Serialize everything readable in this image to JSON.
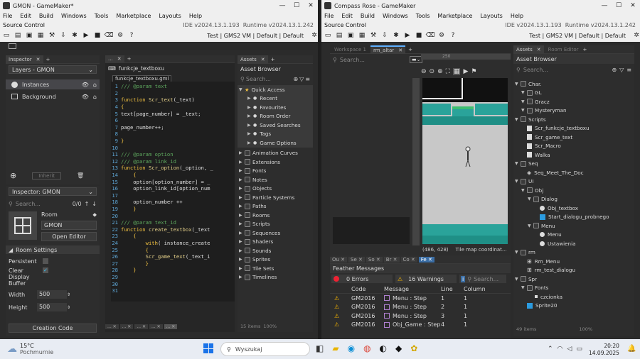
{
  "left": {
    "title": "GMON - GameMaker*",
    "menu": [
      "File",
      "Edit",
      "Build",
      "Windows",
      "Tools",
      "Marketplace",
      "Layouts",
      "Help"
    ],
    "source_control": "Source Control",
    "ide_version": "IDE v2024.13.1.193",
    "runtime_version": "Runtime v2024.13.1.242",
    "target": "Test | GMS2 VM | Default | Default",
    "inspector_tab": "Inspector",
    "layers_title": "Layers - GMON",
    "layers": [
      "Instances",
      "Background"
    ],
    "inherit": "Inherit",
    "inspector2": "Inspector: GMON",
    "search_ph": "Search...",
    "count": "0/0",
    "room_label": "Room",
    "room_name": "GMON",
    "open_editor": "Open Editor",
    "room_settings": "Room Settings",
    "persistent": "Persistent",
    "clear_display": "Clear Display Buffer",
    "width_label": "Width",
    "width_val": "500",
    "height_label": "Height",
    "height_val": "500",
    "creation_code": "Creation Code",
    "code_tab_outer": "funkcje_textboxu",
    "code_file_tab": "funkcje_textboxu.gml",
    "code_lines": [
      {
        "n": "1",
        "parts": [
          {
            "c": "cm",
            "t": "/// @param text"
          }
        ]
      },
      {
        "n": "2",
        "parts": []
      },
      {
        "n": "3",
        "parts": [
          {
            "c": "kw",
            "t": "function "
          },
          {
            "c": "fn",
            "t": "Scr_text"
          },
          {
            "c": "tx",
            "t": "(_text)"
          }
        ]
      },
      {
        "n": "4",
        "parts": [
          {
            "c": "kw",
            "t": "{"
          }
        ]
      },
      {
        "n": "5",
        "parts": [
          {
            "c": "tx",
            "t": "text[page_number] = _text;"
          }
        ]
      },
      {
        "n": "6",
        "parts": []
      },
      {
        "n": "7",
        "parts": [
          {
            "c": "tx",
            "t": "page_number++;"
          }
        ]
      },
      {
        "n": "8",
        "parts": []
      },
      {
        "n": "9",
        "parts": [
          {
            "c": "kw",
            "t": "}"
          }
        ]
      },
      {
        "n": "10",
        "parts": []
      },
      {
        "n": "11",
        "parts": [
          {
            "c": "cm",
            "t": "/// @param option"
          }
        ]
      },
      {
        "n": "12",
        "parts": [
          {
            "c": "cm",
            "t": "/// @param link_id"
          }
        ]
      },
      {
        "n": "13",
        "parts": [
          {
            "c": "kw",
            "t": "function "
          },
          {
            "c": "fn",
            "t": "Scr_option"
          },
          {
            "c": "tx",
            "t": "(_option, _"
          }
        ]
      },
      {
        "n": "14",
        "parts": [
          {
            "c": "kw",
            "t": "    {"
          }
        ]
      },
      {
        "n": "15",
        "parts": [
          {
            "c": "tx",
            "t": "    option[option_number] = _"
          }
        ]
      },
      {
        "n": "16",
        "parts": [
          {
            "c": "tx",
            "t": "    option_link_id[option_num"
          }
        ]
      },
      {
        "n": "17",
        "parts": []
      },
      {
        "n": "18",
        "parts": [
          {
            "c": "tx",
            "t": "    option_number ++"
          }
        ]
      },
      {
        "n": "19",
        "parts": [
          {
            "c": "kw",
            "t": "    }"
          }
        ]
      },
      {
        "n": "20",
        "parts": []
      },
      {
        "n": "21",
        "parts": [
          {
            "c": "cm",
            "t": "/// @param text_id"
          }
        ]
      },
      {
        "n": "22",
        "parts": [
          {
            "c": "kw",
            "t": "function "
          },
          {
            "c": "fn",
            "t": "create_textbox"
          },
          {
            "c": "tx",
            "t": "(_text"
          }
        ]
      },
      {
        "n": "23",
        "parts": [
          {
            "c": "kw",
            "t": "    {"
          }
        ]
      },
      {
        "n": "24",
        "parts": [
          {
            "c": "kw",
            "t": "        with"
          },
          {
            "c": "tx",
            "t": "( instance_create"
          }
        ]
      },
      {
        "n": "25",
        "parts": [
          {
            "c": "kw",
            "t": "        {"
          }
        ]
      },
      {
        "n": "26",
        "parts": [
          {
            "c": "fn",
            "t": "        Scr_game_text"
          },
          {
            "c": "tx",
            "t": "(_text_i"
          }
        ]
      },
      {
        "n": "27",
        "parts": [
          {
            "c": "kw",
            "t": "        }"
          }
        ]
      },
      {
        "n": "28",
        "parts": [
          {
            "c": "kw",
            "t": "    }"
          }
        ]
      },
      {
        "n": "29",
        "parts": []
      },
      {
        "n": "30",
        "parts": []
      },
      {
        "n": "31",
        "parts": []
      }
    ],
    "assets_tab": "Assets",
    "asset_browser": "Asset Browser",
    "quick_access": "Quick Access",
    "qa_items": [
      "Recent",
      "Favourites",
      "Room Order",
      "Saved Searches",
      "Tags",
      "Game Options"
    ],
    "asset_groups": [
      "Animation Curves",
      "Extensions",
      "Fonts",
      "Notes",
      "Objects",
      "Particle Systems",
      "Paths",
      "Rooms",
      "Scripts",
      "Sequences",
      "Shaders",
      "Sounds",
      "Sprites",
      "Tile Sets",
      "Timelines"
    ],
    "items_status": "15 items",
    "zoom_status": "100%"
  },
  "right": {
    "title": "Compass Rose - GameMaker",
    "menu": [
      "File",
      "Edit",
      "Build",
      "Windows",
      "Tools",
      "Marketplace",
      "Layouts",
      "Help"
    ],
    "source_control": "Source Control",
    "ide_version": "IDE v2024.13.1.193",
    "runtime_version": "Runtime v2024.13.1.242",
    "target": "Test | GMS2 VM | Default | Default",
    "tab_workspace": "Workspace 1",
    "tab_room": "rm_altar",
    "search_ph": "Search...",
    "ruler": "250",
    "coords": "(486, 428)",
    "tile_coords": "Tile map coordinat...",
    "bottom_tabs": [
      "Ou",
      "Se",
      "So",
      "Br",
      "Co",
      "Fe"
    ],
    "feather_title": "Feather Messages",
    "errors": "0 Errors",
    "warnings": "16 Warnings",
    "col_code": "Code",
    "col_message": "Message",
    "col_line": "Line",
    "col_column": "Column",
    "messages": [
      {
        "code": "GM2016",
        "msg": "Menu : Step",
        "line": "1",
        "col": "1"
      },
      {
        "code": "GM2016",
        "msg": "Menu : Step",
        "line": "2",
        "col": "1"
      },
      {
        "code": "GM2016",
        "msg": "Menu : Step",
        "line": "3",
        "col": "1"
      },
      {
        "code": "GM2016",
        "msg": "Obj_Game : Step",
        "line": "4",
        "col": "1"
      }
    ],
    "assets_tab": "Assets",
    "room_editor_tab": "Room Editor",
    "asset_browser": "Asset Browser",
    "tree": [
      {
        "d": 1,
        "t": "Char.",
        "k": "fold"
      },
      {
        "d": 2,
        "t": "GL",
        "k": "fold"
      },
      {
        "d": 2,
        "t": "Gracz",
        "k": "fold"
      },
      {
        "d": 2,
        "t": "Mysteryman",
        "k": "fold"
      },
      {
        "d": 1,
        "t": "Scripts",
        "k": "fold"
      },
      {
        "d": 2,
        "t": "Scr_funkcje_textboxu",
        "k": "doc"
      },
      {
        "d": 2,
        "t": "Scr_game_text",
        "k": "doc"
      },
      {
        "d": 2,
        "t": "Scr_Macro",
        "k": "doc"
      },
      {
        "d": 2,
        "t": "Walka",
        "k": "doc"
      },
      {
        "d": 1,
        "t": "Seq",
        "k": "fold"
      },
      {
        "d": 2,
        "t": "Seq_Meet_The_Doc",
        "k": "seq"
      },
      {
        "d": 1,
        "t": "UI",
        "k": "fold"
      },
      {
        "d": 2,
        "t": "Obj",
        "k": "fold"
      },
      {
        "d": 3,
        "t": "Dialog",
        "k": "fold"
      },
      {
        "d": 4,
        "t": "Obj_textbox",
        "k": "obj"
      },
      {
        "d": 4,
        "t": "Start_dialogu_probnego",
        "k": "spr"
      },
      {
        "d": 3,
        "t": "Menu",
        "k": "fold"
      },
      {
        "d": 4,
        "t": "Menu",
        "k": "obj"
      },
      {
        "d": 4,
        "t": "Ustawienia",
        "k": "obj"
      },
      {
        "d": 1,
        "t": "rm",
        "k": "fold"
      },
      {
        "d": 2,
        "t": "Rm_Menu",
        "k": "room"
      },
      {
        "d": 2,
        "t": "rm_test_dialogu",
        "k": "room"
      },
      {
        "d": 1,
        "t": "Spr",
        "k": "fold"
      },
      {
        "d": 2,
        "t": "Fonts",
        "k": "fold"
      },
      {
        "d": 3,
        "t": "czcionka",
        "k": "font"
      },
      {
        "d": 2,
        "t": "Sprite20",
        "k": "spr"
      }
    ],
    "items_status": "49 items",
    "zoom_status": "100%"
  },
  "taskbar": {
    "temp": "15°C",
    "weather": "Pochmurnie",
    "search": "Wyszukaj",
    "time": "20:20",
    "date": "14.09.2025"
  },
  "colors": {
    "accent": "#5fb0ff",
    "feather_tab": "#3b6ea5",
    "room_floor": "#c8c8c8",
    "room_wall": "#2aa39a"
  }
}
